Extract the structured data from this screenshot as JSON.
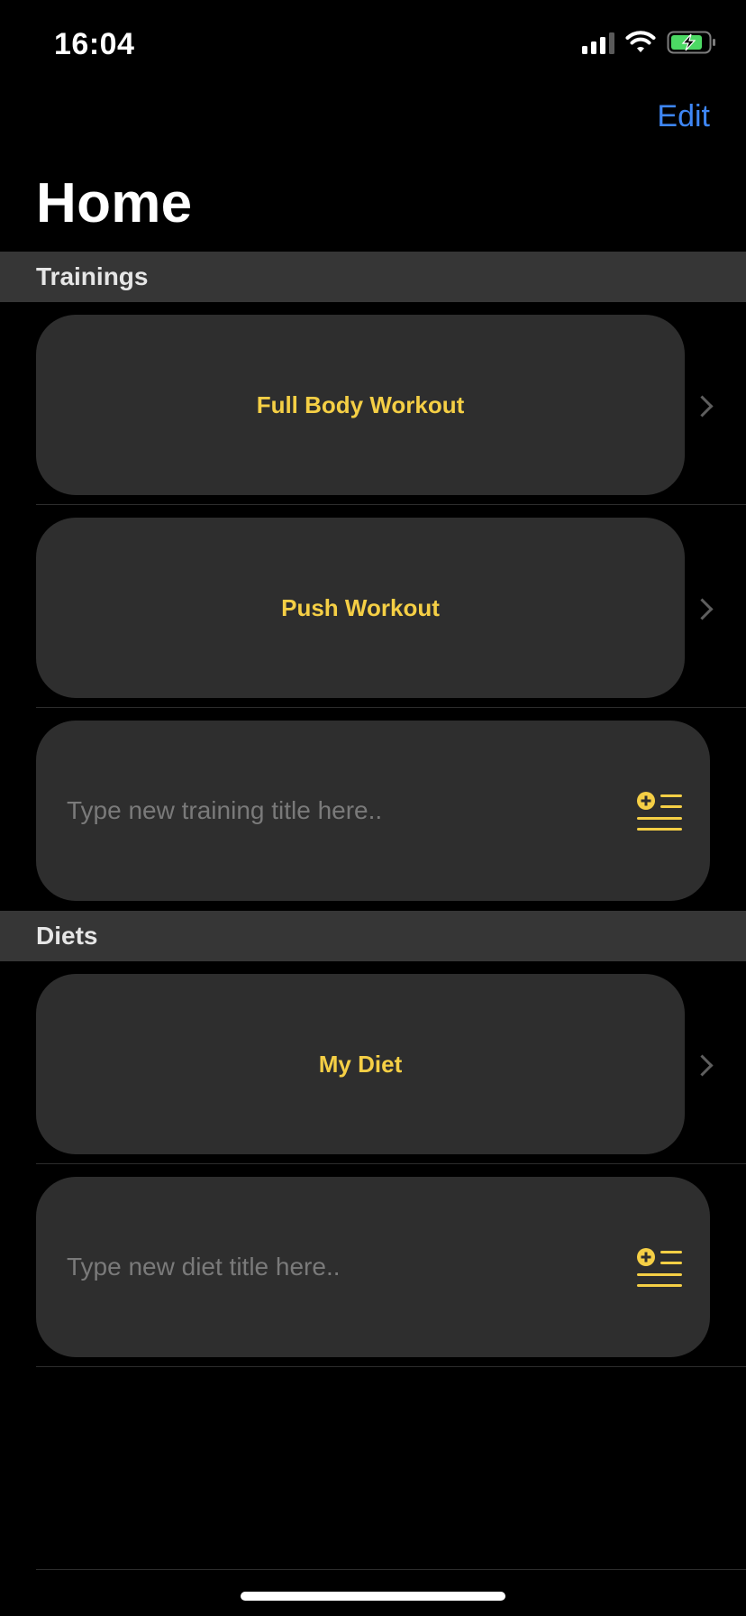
{
  "status_bar": {
    "time": "16:04",
    "icons": [
      "cellular-signal-icon",
      "wifi-icon",
      "battery-charging-icon"
    ]
  },
  "nav": {
    "edit_label": "Edit",
    "title": "Home"
  },
  "sections": {
    "trainings": {
      "header": "Trainings",
      "items": [
        {
          "label": "Full Body Workout"
        },
        {
          "label": "Push Workout"
        }
      ],
      "new_placeholder": "Type new training title here.."
    },
    "diets": {
      "header": "Diets",
      "items": [
        {
          "label": "My Diet"
        }
      ],
      "new_placeholder": "Type new diet title here.."
    }
  },
  "colors": {
    "background": "#000000",
    "card": "#2e2e2e",
    "section_header": "#363636",
    "accent_yellow": "#f5cf45",
    "link_blue": "#3e86f5",
    "battery_green": "#4cd964"
  }
}
